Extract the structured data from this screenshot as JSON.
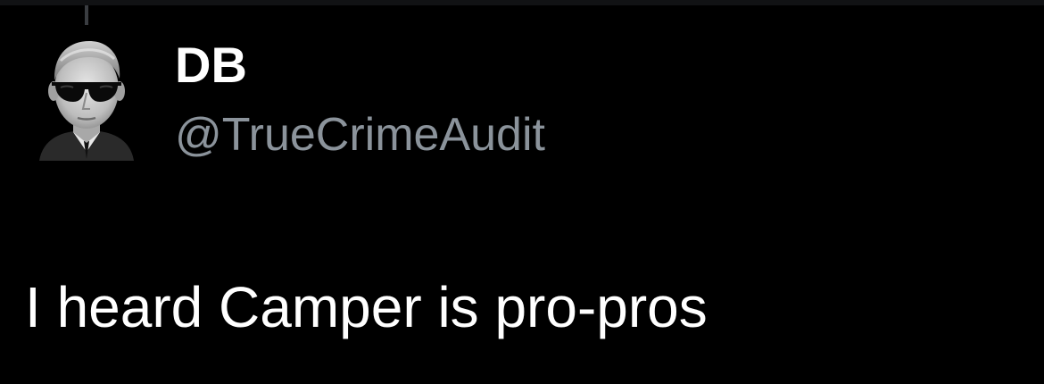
{
  "tweet": {
    "author": {
      "display_name": "DB",
      "handle": "@TrueCrimeAudit",
      "avatar_icon": "avatar-man-sunglasses-icon"
    },
    "text": "I heard Camper is pro-pros"
  },
  "colors": {
    "background": "#000000",
    "primary_text": "#ffffff",
    "secondary_text": "#8b939b",
    "thread_line": "#3a3d41"
  }
}
